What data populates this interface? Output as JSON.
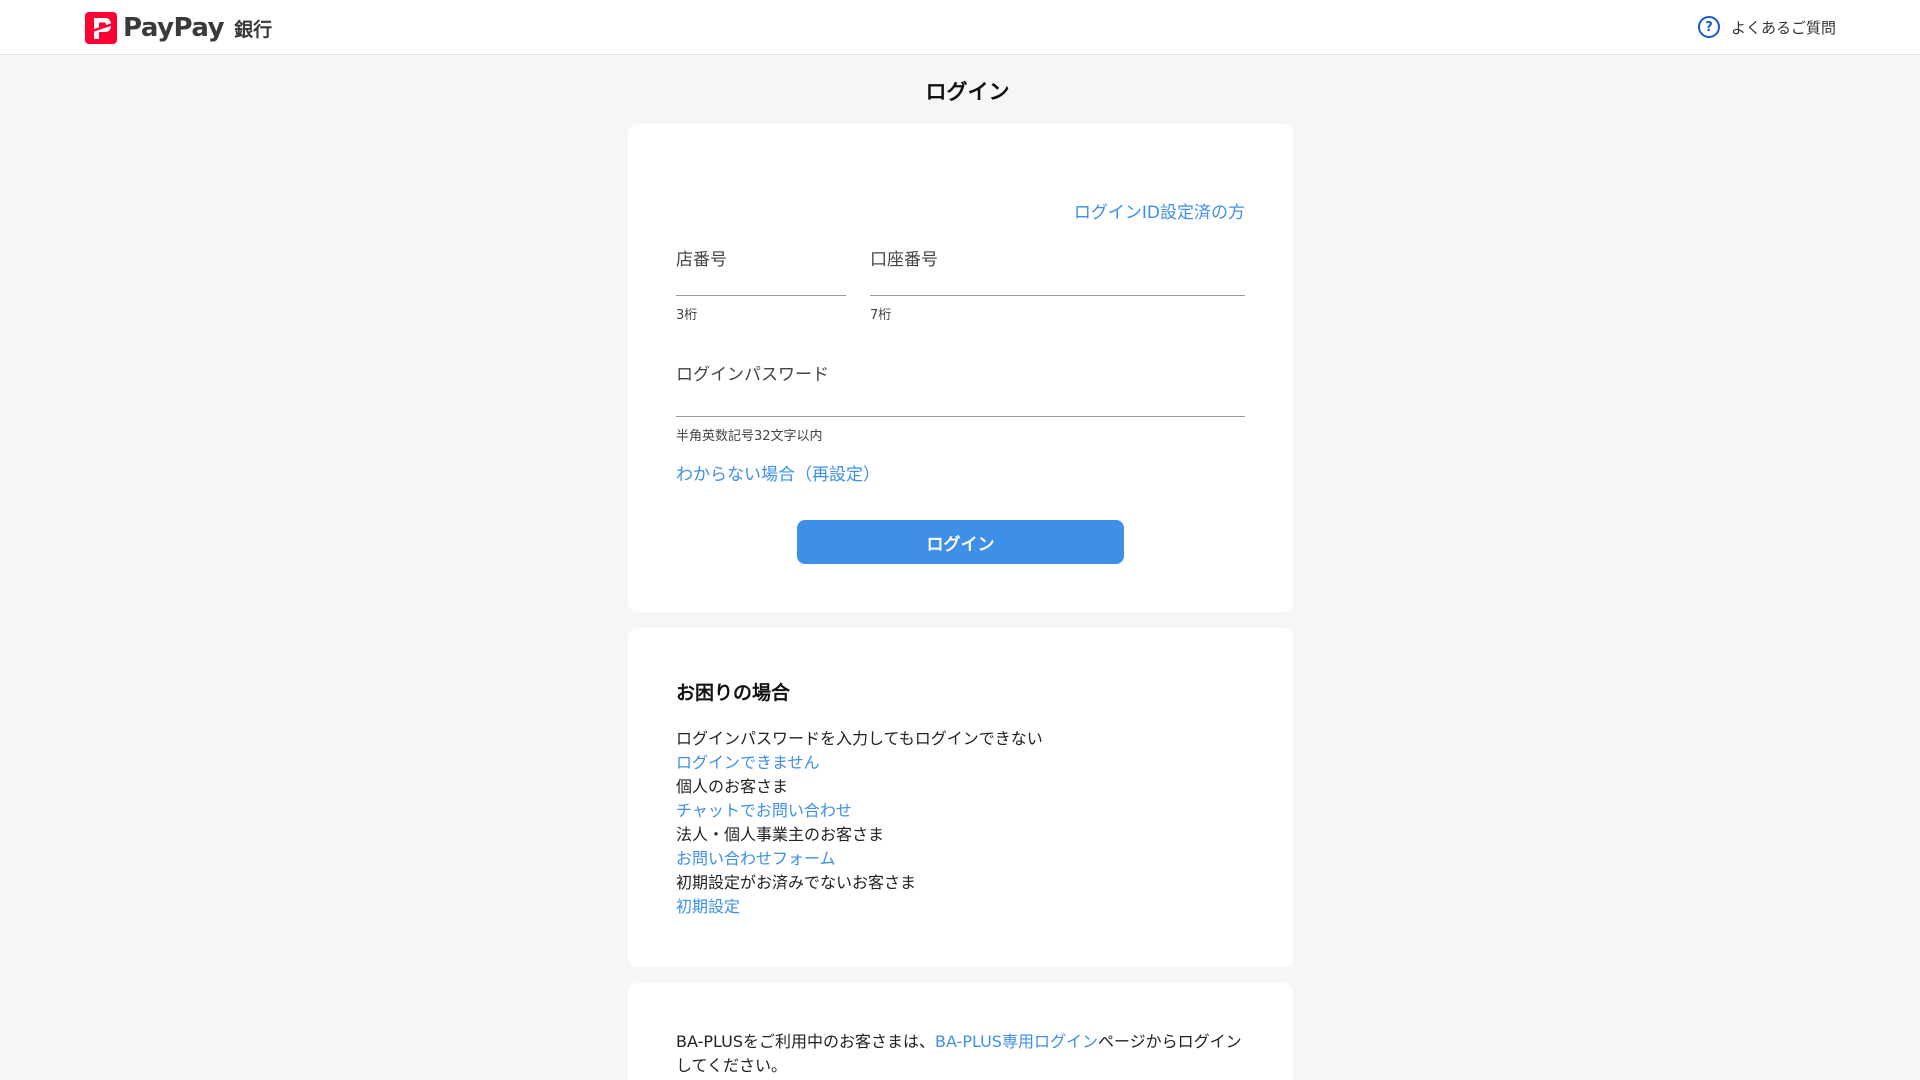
{
  "header": {
    "logo_text": "PayPay",
    "logo_bank": "銀行",
    "faq_label": "よくあるご質問",
    "faq_icon": "question-circle-icon"
  },
  "page": {
    "title": "ログイン"
  },
  "login_form": {
    "id_link": "ログインID設定済の方",
    "branch_label": "店番号",
    "branch_value": "",
    "branch_hint": "3桁",
    "account_label": "口座番号",
    "account_value": "",
    "account_hint": "7桁",
    "password_label": "ログインパスワード",
    "password_value": "",
    "password_hint": "半角英数記号32文字以内",
    "reset_link": "わからない場合（再設定）",
    "submit_label": "ログイン"
  },
  "help": {
    "title": "お困りの場合",
    "items": [
      {
        "text": "ログインパスワードを入力してもログインできない",
        "link": "ログインできません"
      },
      {
        "text": "個人のお客さま",
        "link": "チャットでお問い合わせ"
      },
      {
        "text": "法人・個人事業主のお客さま",
        "link": "お問い合わせフォーム"
      },
      {
        "text": "初期設定がお済みでないお客さま",
        "link": "初期設定"
      }
    ]
  },
  "baplus": {
    "prefix": "BA-PLUSをご利用中のお客さまは、",
    "link": "BA-PLUS専用ログイン",
    "suffix": "ページからログインしてください。"
  },
  "colors": {
    "brand": "#ff0033",
    "link": "#3d8fe8",
    "button": "#3d8fe8",
    "background": "#f6f6f6"
  }
}
